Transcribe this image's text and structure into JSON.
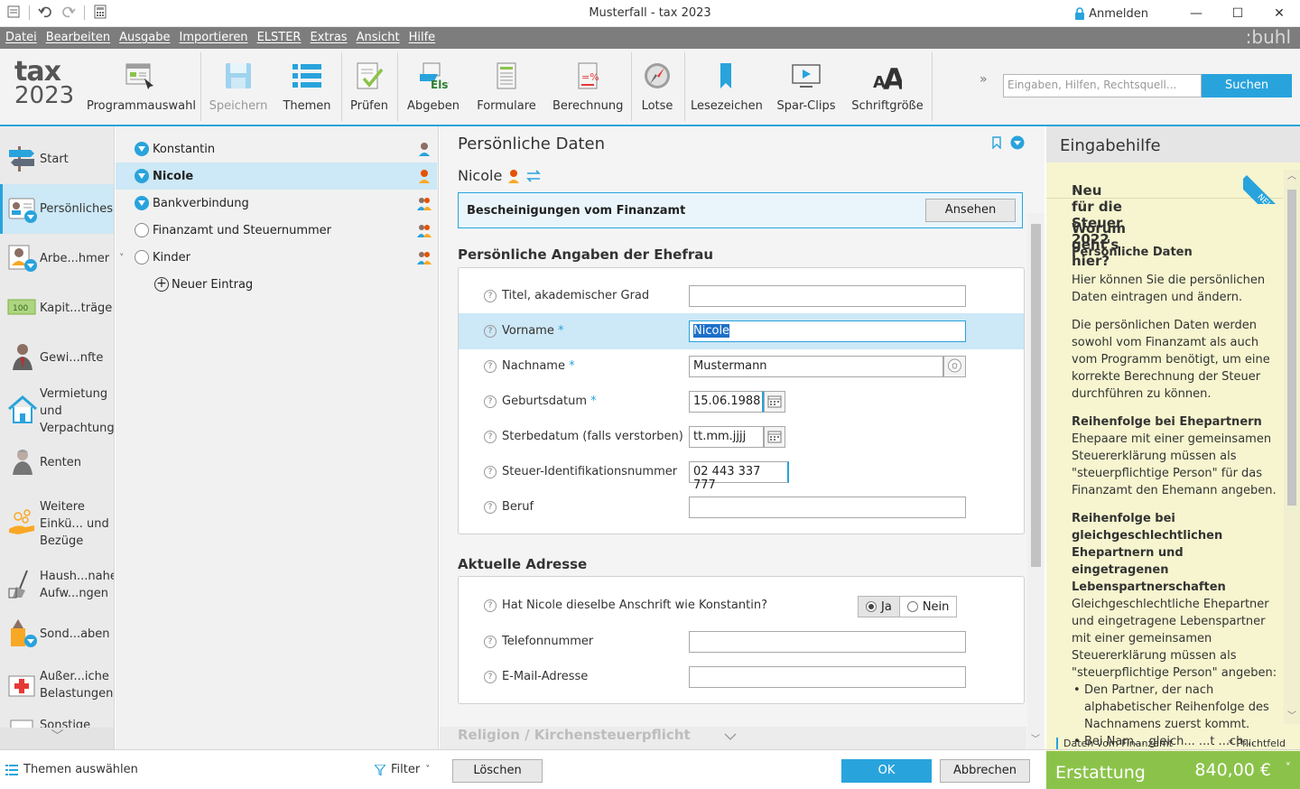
{
  "window": {
    "title": "Musterfall - tax 2023",
    "login_label": "Anmelden"
  },
  "menu": [
    "Datei",
    "Bearbeiten",
    "Ausgabe",
    "Importieren",
    "ELSTER",
    "Extras",
    "Ansicht",
    "Hilfe"
  ],
  "brand": ":buhl",
  "logo": {
    "line1": "tax",
    "line2": "2023"
  },
  "toolbar": {
    "programmauswahl": "Programmauswahl",
    "speichern": "Speichern",
    "themen": "Themen",
    "pruefen": "Prüfen",
    "abgeben": "Abgeben",
    "formulare": "Formulare",
    "berechnung": "Berechnung",
    "lotse": "Lotse",
    "lesezeichen": "Lesezeichen",
    "sparclips": "Spar-Clips",
    "schriftgroesse": "Schriftgröße",
    "search_placeholder": "Eingaben, Hilfen, Rechtsquell...",
    "search_button": "Suchen"
  },
  "sidebar": {
    "items": [
      {
        "label": "Start"
      },
      {
        "label": "Persönliches"
      },
      {
        "label": "Arbe...hmer"
      },
      {
        "label": "Kapit...träge"
      },
      {
        "label": "Gewi...nfte"
      },
      {
        "label": "Vermietung und Verpachtung"
      },
      {
        "label": "Renten"
      },
      {
        "label": "Weitere Einkü... und Bezüge"
      },
      {
        "label": "Haush...nahe Aufw...ngen"
      },
      {
        "label": "Sond...aben"
      },
      {
        "label": "Außer...iche Belastungen"
      },
      {
        "label": "Sonstige"
      }
    ],
    "kapital_badge": "100"
  },
  "tree": {
    "items": [
      {
        "label": "Konstantin"
      },
      {
        "label": "Nicole"
      },
      {
        "label": "Bankverbindung"
      },
      {
        "label": "Finanzamt und Steuernummer"
      },
      {
        "label": "Kinder"
      }
    ],
    "new_entry": "Neuer Eintrag"
  },
  "content": {
    "title": "Persönliche Daten",
    "person": "Nicole",
    "cert_label": "Bescheinigungen vom Finanzamt",
    "cert_button": "Ansehen",
    "section1": "Persönliche Angaben der Ehefrau",
    "fields": {
      "titel": {
        "label": "Titel, akademischer Grad",
        "value": ""
      },
      "vorname": {
        "label": "Vorname",
        "value": "Nicole"
      },
      "nachname": {
        "label": "Nachname",
        "value": "Mustermann"
      },
      "geburtsdatum": {
        "label": "Geburtsdatum",
        "value": "15.06.1988"
      },
      "sterbedatum": {
        "label": "Sterbedatum (falls verstorben)",
        "value": "tt.mm.jjjj"
      },
      "steuerid": {
        "label": "Steuer-Identifikationsnummer",
        "value": "02 443 337 777"
      },
      "beruf": {
        "label": "Beruf",
        "value": ""
      }
    },
    "required_mark": "*",
    "section2": "Aktuelle Adresse",
    "address": {
      "same_label": "Hat Nicole dieselbe Anschrift wie Konstantin?",
      "yes": "Ja",
      "no": "Nein",
      "telefon": "Telefonnummer",
      "email": "E-Mail-Adresse"
    },
    "section3": "Religion / Kirchensteuerpflicht"
  },
  "help": {
    "title": "Eingabehilfe",
    "neu_badge": "NEU",
    "sec1": "Neu für die Steuer 2022",
    "sec2": "Worum geht's hier?",
    "h1": "Persönliche Daten",
    "p1": "Hier können Sie die persönlichen Daten eintragen und ändern.",
    "p2": "Die persönlichen Daten werden sowohl vom Finanzamt als auch vom Programm benötigt, um eine korrekte Berechnung der Steuer durchführen zu können.",
    "h2": "Reihenfolge bei Ehepartnern",
    "p3": "Ehepaare mit einer gemeinsamen Steuererklärung müssen als \"steuerpflichtige Person\" für das Finanzamt den Ehemann angeben.",
    "h3": "Reihenfolge bei gleichgeschlechtlichen Ehepartnern und eingetragenen Lebenspartnerschaften",
    "p4": "Gleichgeschlechtliche Ehepartner und eingetragene Lebenspartner mit einer gemeinsamen Steuererklärung müssen als \"steuerpflichtige Person\" angeben:",
    "bullet1": "Den Partner, der nach alphabetischer Reihenfolge des Nachnamens zuerst kommt.",
    "bullet2": "Bei Nam... gleich... ...t ...ch..."
  },
  "bottom": {
    "themen": "Themen auswählen",
    "filter": "Filter",
    "loeschen": "Löschen",
    "ok": "OK",
    "abbrechen": "Abbrechen",
    "legend_left": "Daten vom Finanzamt",
    "legend_right": "* Pflichtfeld",
    "erstattung_label": "Erstattung",
    "erstattung_value": "840,00 €"
  },
  "colors": {
    "accent": "#29a3dc",
    "erstattung": "#8bc34a",
    "help_bg": "#f6f5cf",
    "menubar": "#7d7d7d"
  }
}
